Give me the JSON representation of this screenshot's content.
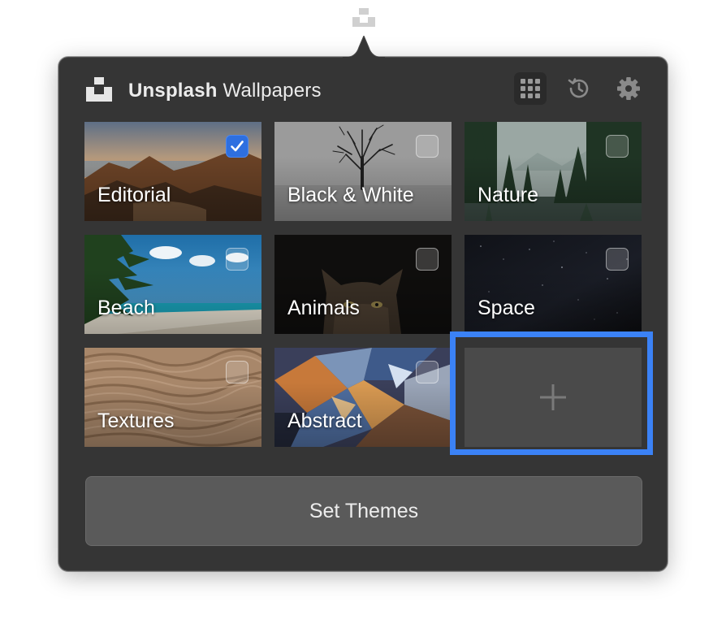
{
  "app": {
    "title_bold": "Unsplash",
    "title_rest": " Wallpapers",
    "menubar_icon": "unsplash-logo-icon"
  },
  "header": {
    "buttons": [
      {
        "name": "grid-icon",
        "active": true
      },
      {
        "name": "history-icon",
        "active": false
      },
      {
        "name": "gear-icon",
        "active": false
      }
    ]
  },
  "themes": [
    {
      "label": "Editorial",
      "checked": true
    },
    {
      "label": "Black & White",
      "checked": false
    },
    {
      "label": "Nature",
      "checked": false
    },
    {
      "label": "Beach",
      "checked": false
    },
    {
      "label": "Animals",
      "checked": false
    },
    {
      "label": "Space",
      "checked": false
    },
    {
      "label": "Textures",
      "checked": false
    },
    {
      "label": "Abstract",
      "checked": false
    }
  ],
  "add_tile": {
    "icon": "plus-icon"
  },
  "set_button": {
    "label": "Set Themes"
  },
  "colors": {
    "panel": "#353535",
    "accent": "#3b82f6",
    "checkbox_checked": "#2e6fe0"
  }
}
